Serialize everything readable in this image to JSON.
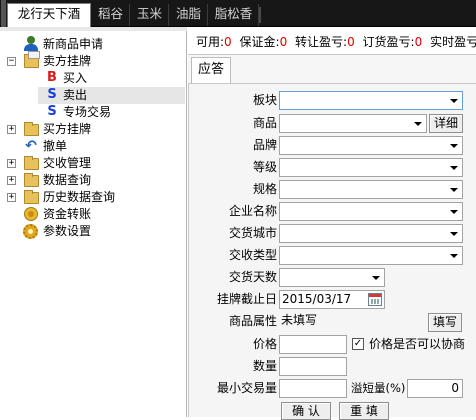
{
  "tabs": [
    {
      "label": "龙行天下酒",
      "active": true
    },
    {
      "label": "稻谷",
      "active": false
    },
    {
      "label": "玉米",
      "active": false
    },
    {
      "label": "油脂",
      "active": false
    },
    {
      "label": "脂松香",
      "active": false
    }
  ],
  "tree": [
    {
      "label": "新商品申请",
      "icon": "person-icon"
    },
    {
      "label": "卖方挂牌",
      "icon": "folder-open-icon",
      "expander": "−"
    },
    {
      "label": "买入",
      "icon": "b-icon",
      "glyph": "B"
    },
    {
      "label": "卖出",
      "icon": "s-icon",
      "glyph": "S"
    },
    {
      "label": "专场交易",
      "icon": "s-icon",
      "glyph": "S"
    },
    {
      "label": "买方挂牌",
      "icon": "folder-icon",
      "expander": "+"
    },
    {
      "label": "撤单",
      "icon": "undo-icon",
      "glyph": "↶"
    },
    {
      "label": "交收管理",
      "icon": "folder-icon",
      "expander": "+"
    },
    {
      "label": "数据查询",
      "icon": "folder-icon",
      "expander": "+"
    },
    {
      "label": "历史数据查询",
      "icon": "folder-icon",
      "expander": "+"
    },
    {
      "label": "资金转账",
      "icon": "coin-icon"
    },
    {
      "label": "参数设置",
      "icon": "gear-icon"
    }
  ],
  "status": {
    "items": [
      {
        "label": "可用:",
        "value": "0"
      },
      {
        "label": "保证金:",
        "value": "0"
      },
      {
        "label": "转让盈亏:",
        "value": "0"
      },
      {
        "label": "订货盈亏:",
        "value": "0"
      },
      {
        "label": "实时盈亏",
        "value": ""
      }
    ]
  },
  "subtab": {
    "label": "应答"
  },
  "form": {
    "sector_label": "板块",
    "sector_value": "",
    "product_label": "商品",
    "product_value": "",
    "detail_button": "详细",
    "brand_label": "品牌",
    "grade_label": "等级",
    "spec_label": "规格",
    "company_label": "企业名称",
    "city_label": "交货城市",
    "settle_type_label": "交收类型",
    "delivery_days_label": "交货天数",
    "deadline_label": "挂牌截止日",
    "deadline_value": "2015/03/17",
    "attr_label": "商品属性",
    "attr_value": "未填写",
    "fill_button": "填写",
    "price_label": "价格",
    "negotiable_label": "价格是否可以协商",
    "negotiable_checked": "✓",
    "qty_label": "数量",
    "min_qty_label": "最小交易量",
    "overflow_label": "溢短量(%)",
    "overflow_value": "0",
    "confirm_button": "确 认",
    "reset_button": "重 填"
  }
}
